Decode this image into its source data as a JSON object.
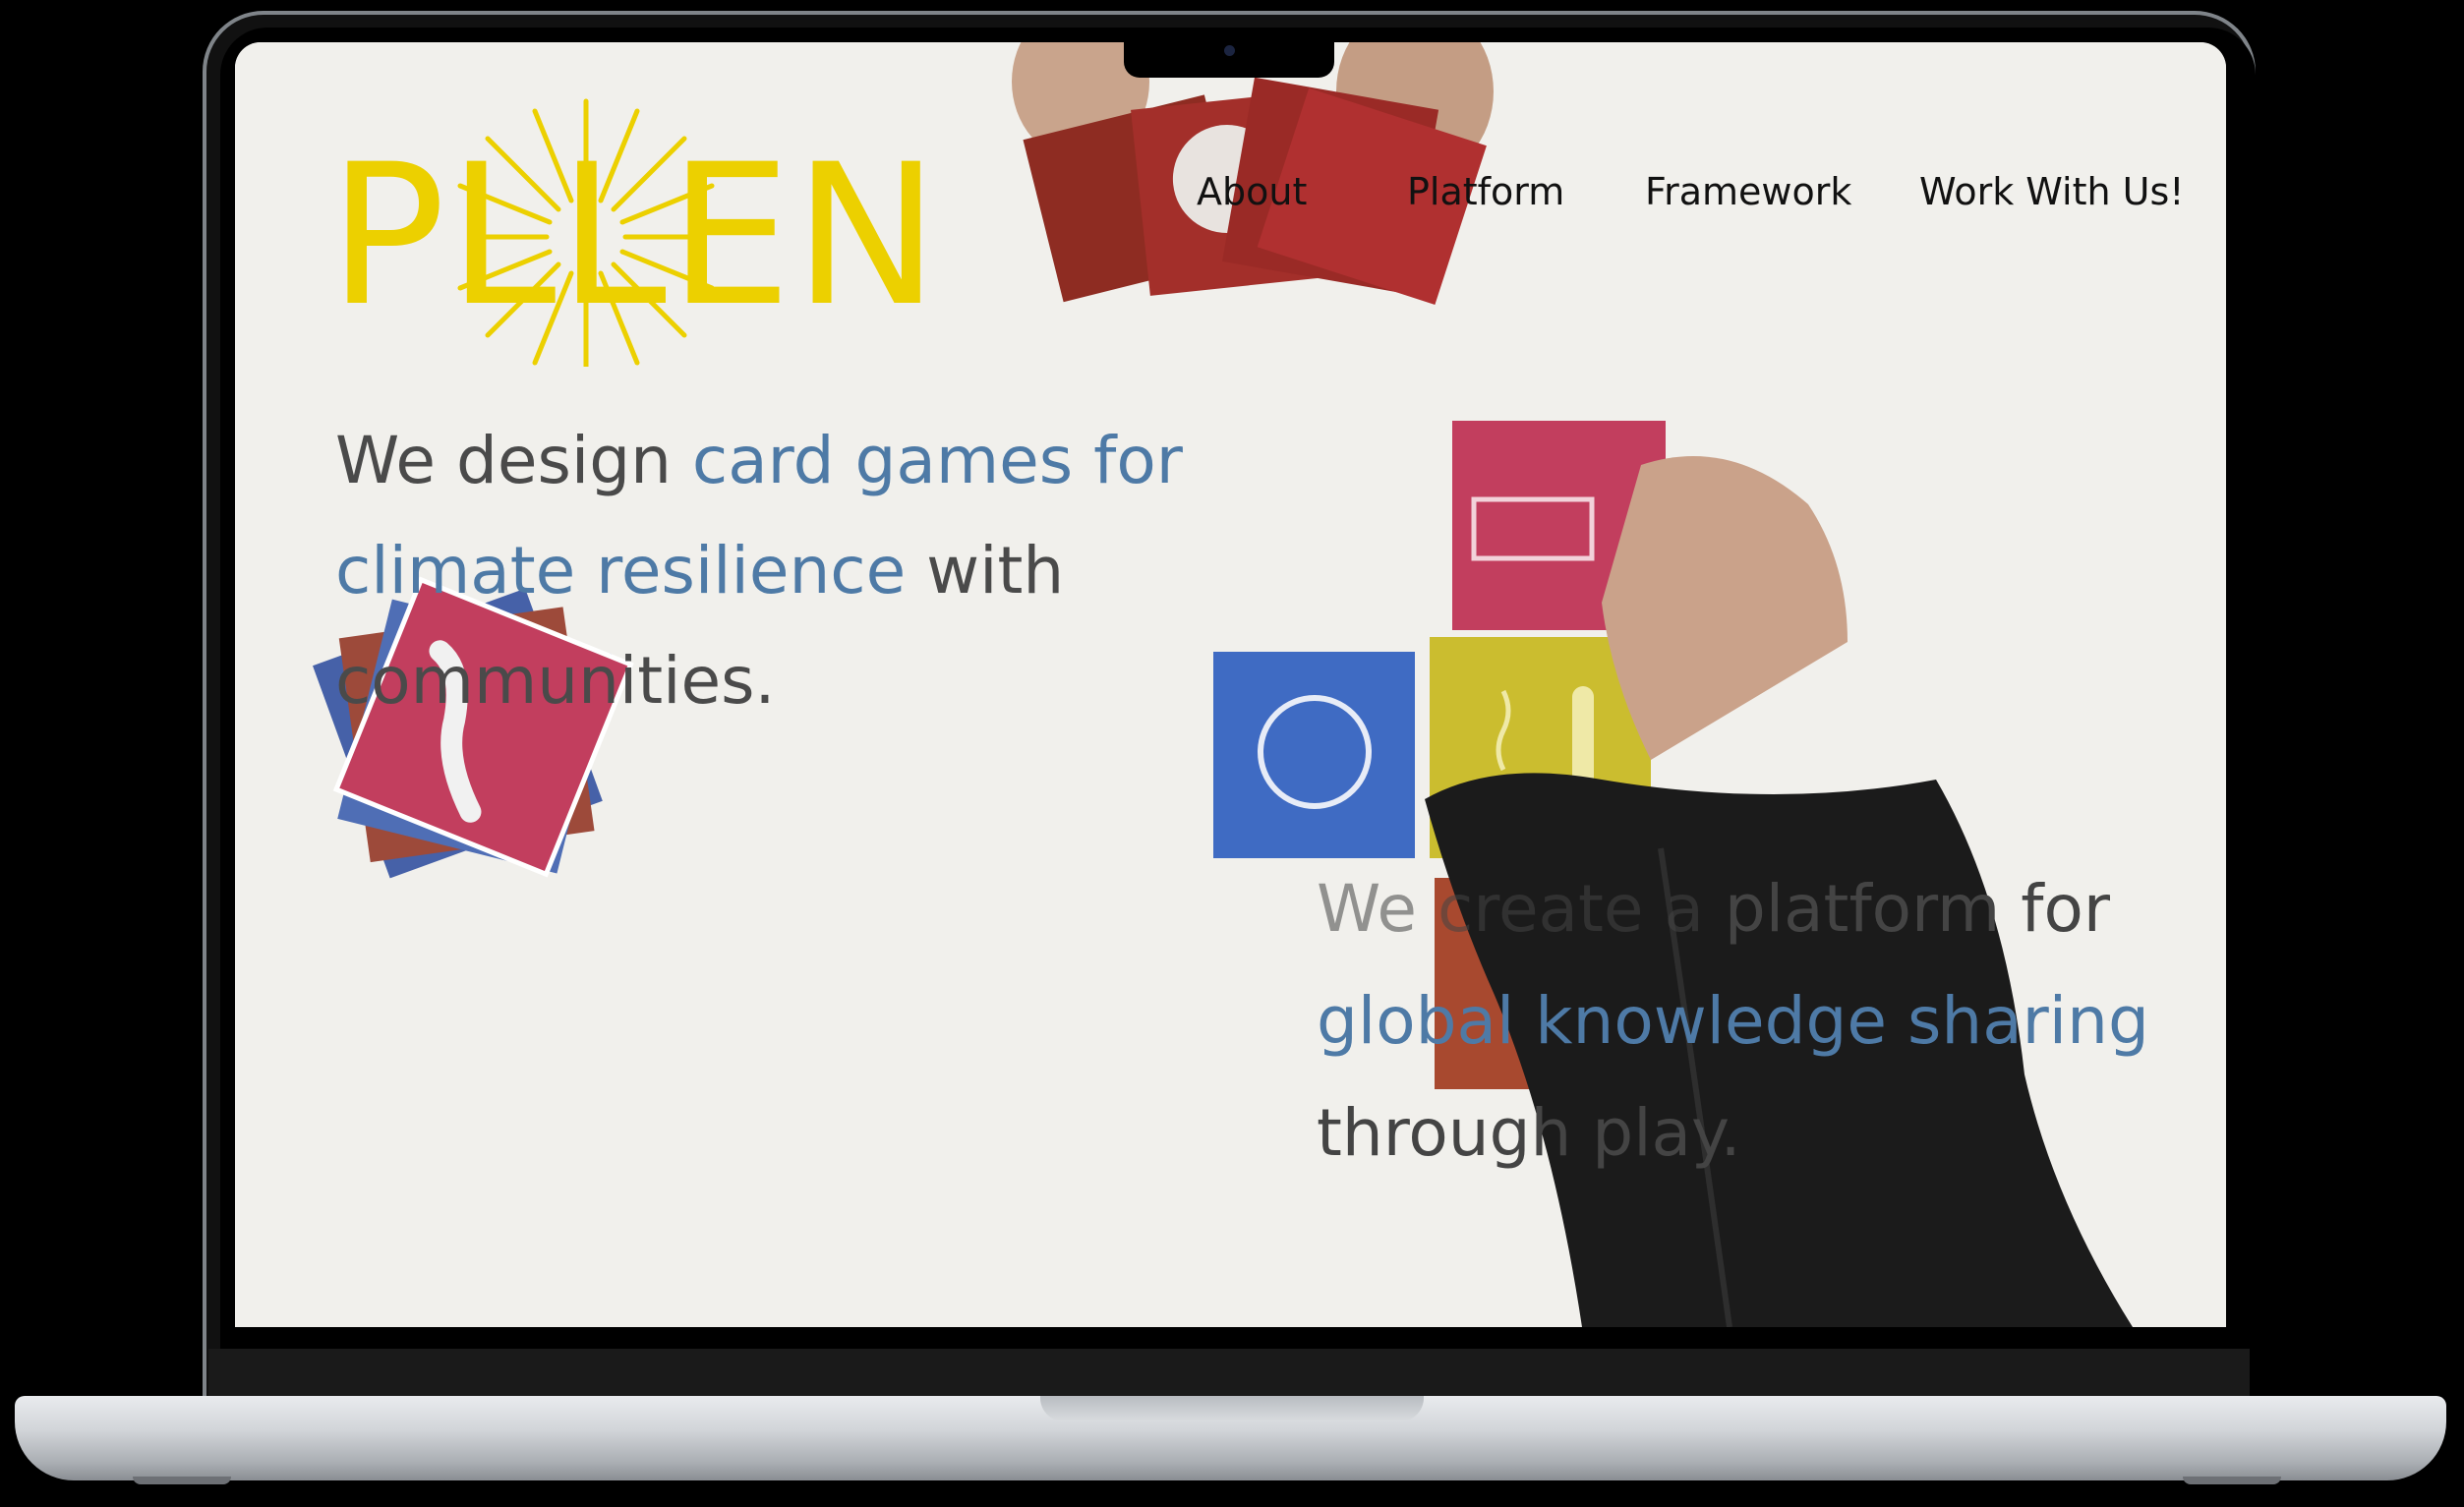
{
  "brand": {
    "logo_text": "PLLEN",
    "logo_color": "#ecd000"
  },
  "nav": {
    "items": [
      {
        "label": "About"
      },
      {
        "label": "Platform"
      },
      {
        "label": "Framework"
      },
      {
        "label": "Work With Us!"
      }
    ]
  },
  "hero": {
    "part1": "We design ",
    "highlight1": "card games for climate resilience",
    "part2": " with communities."
  },
  "hero2": {
    "ghost1": "We create a",
    "part1": " platform for ",
    "highlight1": "global knowledge sharing",
    "part2": " through play."
  },
  "colors": {
    "text": "#4a4a4a",
    "accent": "#4e7aa6",
    "background": "#f1f0ec"
  },
  "icons": [
    "sun-burst-icon",
    "card-icon"
  ]
}
